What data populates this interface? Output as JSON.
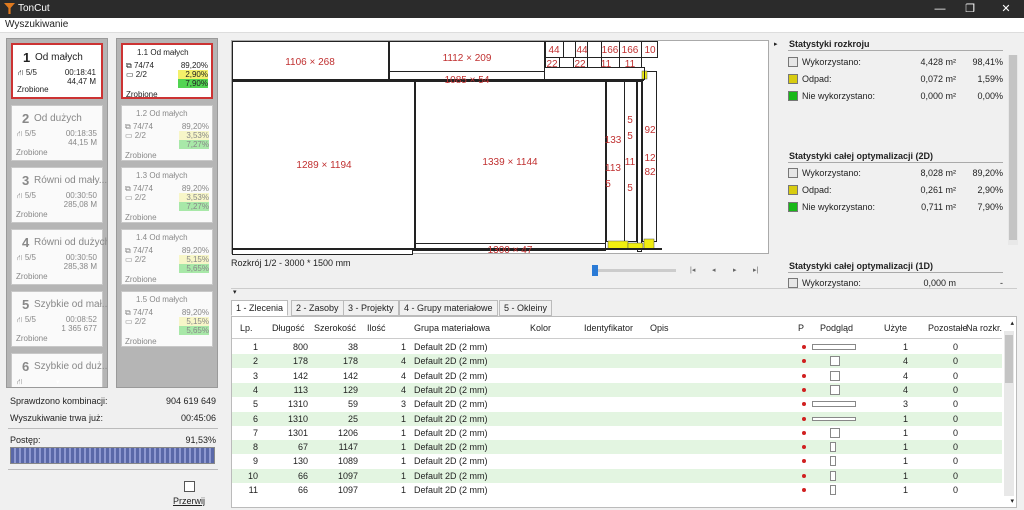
{
  "app": {
    "title": "TonCut",
    "menu": "Wyszukiwanie"
  },
  "strategies": [
    {
      "num": "1",
      "name": "Od małych",
      "routes": "5/5",
      "time": "00:18:41",
      "value": "44,47 M",
      "status": "Zrobione"
    },
    {
      "num": "2",
      "name": "Od dużych",
      "routes": "5/5",
      "time": "00:18:35",
      "value": "44,15 M",
      "status": "Zrobione"
    },
    {
      "num": "3",
      "name": "Równi od mały...",
      "routes": "5/5",
      "time": "00:30:50",
      "value": "285,08 M",
      "status": "Zrobione"
    },
    {
      "num": "4",
      "name": "Równi od dużych",
      "routes": "5/5",
      "time": "00:30:50",
      "value": "285,38 M",
      "status": "Zrobione"
    },
    {
      "num": "5",
      "name": "Szybkie od mał...",
      "routes": "5/5",
      "time": "00:08:52",
      "value": "1 365 677",
      "status": "Zrobione"
    },
    {
      "num": "6",
      "name": "Szybkie od duż...",
      "routes": "",
      "time": "",
      "value": "",
      "status": ""
    }
  ],
  "substrategies": [
    {
      "name": "1.1  Od małych",
      "a": "74/74",
      "b": "2/2",
      "p1": "89,20%",
      "p2": "2,90%",
      "p3": "7,90%",
      "status": "Zrobione"
    },
    {
      "name": "1.2  Od małych",
      "a": "74/74",
      "b": "2/2",
      "p1": "89,20%",
      "p2": "3,53%",
      "p3": "7,27%",
      "status": "Zrobione"
    },
    {
      "name": "1.3  Od małych",
      "a": "74/74",
      "b": "2/2",
      "p1": "89,20%",
      "p2": "3,53%",
      "p3": "7,27%",
      "status": "Zrobione"
    },
    {
      "name": "1.4  Od małych",
      "a": "74/74",
      "b": "2/2",
      "p1": "89,20%",
      "p2": "5,15%",
      "p3": "5,65%",
      "status": "Zrobione"
    },
    {
      "name": "1.5  Od małych",
      "a": "74/74",
      "b": "2/2",
      "p1": "89,20%",
      "p2": "5,15%",
      "p3": "5,65%",
      "status": "Zrobione"
    }
  ],
  "search_stats": {
    "checked_label": "Sprawdzono kombinacji:",
    "checked_value": "904 619 649",
    "duration_label": "Wyszukiwanie trwa już:",
    "duration_value": "00:45:06",
    "progress_label": "Postęp:",
    "progress_value": "91,53%",
    "progress_fraction": 0.9153,
    "stop_label": "Przerwij"
  },
  "cut_labels": [
    "1106 × 268",
    "1112 × 209",
    "1085 × 54",
    "1289 × 1194",
    "1339 × 1144",
    "1300 × 47",
    "133",
    "113",
    "5",
    "44",
    "22",
    "166",
    "11",
    "10",
    "92",
    "12",
    "82"
  ],
  "cut_caption": "Rozkrój 1/2 - 3000 * 1500 mm",
  "nav_icons": [
    "first-icon",
    "prev-icon",
    "next-icon",
    "last-icon"
  ],
  "nav_glyphs": [
    "|◂",
    "◂",
    "▸",
    "▸|"
  ],
  "stats_cut": {
    "title": "Statystyki rozkroju",
    "rows": [
      {
        "label": "Wykorzystano:",
        "v1": "4,428 m²",
        "v2": "98,41%",
        "color": "#e6e6e6"
      },
      {
        "label": "Odpad:",
        "v1": "0,072 m²",
        "v2": "1,59%",
        "color": "#d8cc10"
      },
      {
        "label": "Nie wykorzystano:",
        "v1": "0,000 m²",
        "v2": "0,00%",
        "color": "#18b818"
      }
    ]
  },
  "stats_opt2d": {
    "title": "Statystyki całej optymalizacji (2D)",
    "rows": [
      {
        "label": "Wykorzystano:",
        "v1": "8,028 m²",
        "v2": "89,20%",
        "color": "#e6e6e6"
      },
      {
        "label": "Odpad:",
        "v1": "0,261 m²",
        "v2": "2,90%",
        "color": "#d8cc10"
      },
      {
        "label": "Nie wykorzystano:",
        "v1": "0,711 m²",
        "v2": "7,90%",
        "color": "#18b818"
      }
    ]
  },
  "stats_opt1d": {
    "title": "Statystyki całej optymalizacji (1D)",
    "rows": [
      {
        "label": "Wykorzystano:",
        "v1": "0,000 m",
        "v2": "-",
        "color": "#e6e6e6"
      }
    ]
  },
  "tabs": [
    "1 - Zlecenia",
    "2 - Zasoby",
    "3 - Projekty",
    "4 - Grupy materiałowe",
    "5 - Okleiny"
  ],
  "table": {
    "headers": [
      "Lp.",
      "Długość",
      "Szerokość",
      "Ilość",
      "Grupa materiałowa",
      "Kolor",
      "Identyfikator",
      "Opis",
      "P",
      "Podgląd",
      "Użyte",
      "Pozostałe",
      "Na rozkr."
    ],
    "rows": [
      {
        "lp": "1",
        "len": "800",
        "wid": "38",
        "qty": "1",
        "grp": "Default 2D (2 mm)",
        "used": "1",
        "left": "0"
      },
      {
        "lp": "2",
        "len": "178",
        "wid": "178",
        "qty": "4",
        "grp": "Default 2D (2 mm)",
        "used": "4",
        "left": "0"
      },
      {
        "lp": "3",
        "len": "142",
        "wid": "142",
        "qty": "4",
        "grp": "Default 2D (2 mm)",
        "used": "4",
        "left": "0"
      },
      {
        "lp": "4",
        "len": "113",
        "wid": "129",
        "qty": "4",
        "grp": "Default 2D (2 mm)",
        "used": "4",
        "left": "0"
      },
      {
        "lp": "5",
        "len": "1310",
        "wid": "59",
        "qty": "3",
        "grp": "Default 2D (2 mm)",
        "used": "3",
        "left": "0"
      },
      {
        "lp": "6",
        "len": "1310",
        "wid": "25",
        "qty": "1",
        "grp": "Default 2D (2 mm)",
        "used": "1",
        "left": "0"
      },
      {
        "lp": "7",
        "len": "1301",
        "wid": "1206",
        "qty": "1",
        "grp": "Default 2D (2 mm)",
        "used": "1",
        "left": "0"
      },
      {
        "lp": "8",
        "len": "67",
        "wid": "1147",
        "qty": "1",
        "grp": "Default 2D (2 mm)",
        "used": "1",
        "left": "0"
      },
      {
        "lp": "9",
        "len": "130",
        "wid": "1089",
        "qty": "1",
        "grp": "Default 2D (2 mm)",
        "used": "1",
        "left": "0"
      },
      {
        "lp": "10",
        "len": "66",
        "wid": "1097",
        "qty": "1",
        "grp": "Default 2D (2 mm)",
        "used": "1",
        "left": "0"
      },
      {
        "lp": "11",
        "len": "66",
        "wid": "1097",
        "qty": "1",
        "grp": "Default 2D (2 mm)",
        "used": "1",
        "left": "0"
      }
    ]
  }
}
